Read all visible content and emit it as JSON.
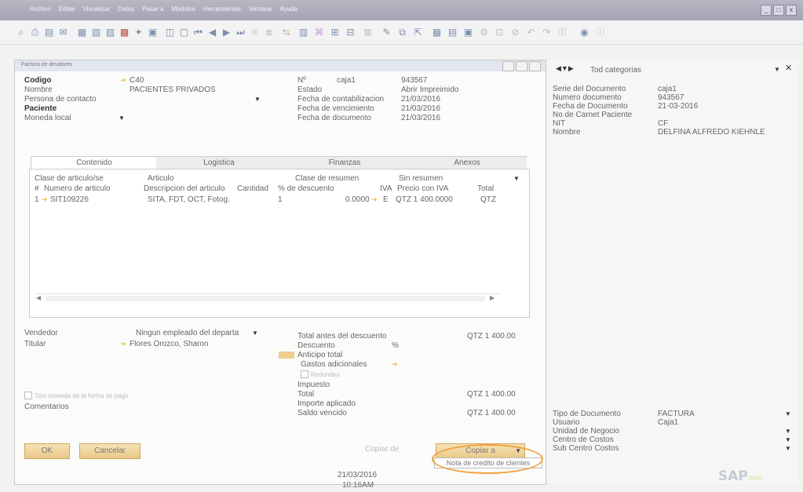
{
  "menubar": {
    "items": [
      "Archivo",
      "Editar",
      "Visualizar",
      "Datos",
      "Pasar a",
      "Módulos",
      "Herramientas",
      "Ventana",
      "Ayuda"
    ],
    "window_controls": [
      "_",
      "□",
      "x"
    ]
  },
  "toolbar": {
    "icons": [
      "search-icon",
      "print-icon",
      "preview-icon",
      "email-icon",
      "excel-icon",
      "word-icon",
      "pdf-icon",
      "settings-icon",
      "find-icon",
      "first-record-icon",
      "prev-record-icon",
      "next-record-icon",
      "last-record-icon",
      "filter-icon",
      "sort-icon",
      "doc-link-icon",
      "drill-icon",
      "copy-icon",
      "layout-icon",
      "calendar-icon",
      "help-icon"
    ]
  },
  "document": {
    "title": "Factura de deudores",
    "codigo_label": "Codigo",
    "codigo_value": "C40",
    "nombre_label": "Nombre",
    "nombre_value": "PACIENTES PRIVADOS",
    "persona_label": "Persona de contacto",
    "paciente_label": "Paciente",
    "moneda_label": "Moneda local",
    "no_label": "Nº",
    "no_series": "caja1",
    "no_value": "943567",
    "estado_label": "Estado",
    "estado_value": "Abrir  Impreimido",
    "fecha_contab_label": "Fecha de contabilizacion",
    "fecha_contab_value": "21/03/2016",
    "fecha_venc_label": "Fecha de vencimiento",
    "fecha_venc_value": "21/03/2016",
    "fecha_doc_label": "Fecha de documento",
    "fecha_doc_value": "21/03/2016"
  },
  "tabs": [
    "Contenido",
    "Logistica",
    "Finanzas",
    "Anexos"
  ],
  "grid": {
    "clase_articulo_label": "Clase de articulo/se",
    "clase_articulo_value": "Articulo",
    "clase_resumen_label": "Clase de resumen",
    "clase_resumen_value": "Sin resumen",
    "columns": [
      "#",
      "Numero de articulo",
      "Descripcion del articulo",
      "Cantidad",
      "% de descuento",
      "IVA",
      "Precio con IVA",
      "Total"
    ],
    "rows": [
      {
        "num": "1",
        "articulo": "SIT109226",
        "descripcion": "SITA, FDT, OCT, Fotog.",
        "cantidad": "1",
        "descuento": "0.0000",
        "iva": "E",
        "precio": "QTZ 1 400.0000",
        "total": "QTZ"
      }
    ]
  },
  "bottom": {
    "vendedor_label": "Vendedor",
    "vendedor_value": "Ningun empleado del departa",
    "titular_label": "Titular",
    "titular_value": "Flores Orozco, Sharon",
    "checkbox_label": "Tipo moneda de la forma de pago",
    "comentarios_label": "Comentarios",
    "total_antes_label": "Total antes del descuento",
    "total_antes_value": "QTZ 1 400.00",
    "descuento_label": "Descuento",
    "descuento_pct": "%",
    "anticipo_label": "Anticipo total",
    "gastos_label": "Gastos adicionales",
    "redondeo_label": "Redondeo",
    "impuesto_label": "Impuesto",
    "total_label": "Total",
    "total_value": "QTZ 1 400.00",
    "importe_label": "Importe aplicado",
    "saldo_label": "Saldo vencido",
    "saldo_value": "QTZ 1 400.00"
  },
  "buttons": {
    "ok": "OK",
    "cancelar": "Cancelar",
    "copiar_de": "Copiar de",
    "copiar_a": "Copiar a",
    "dropdown_option": "Nota de credito de clientes"
  },
  "right_panel": {
    "category": "Tod categorias",
    "fields": [
      {
        "label": "Serie del Documento",
        "value": "caja1"
      },
      {
        "label": "Numero documento",
        "value": "943567"
      },
      {
        "label": "Fecha de Documento",
        "value": "21-03-2016"
      },
      {
        "label": "No de Carnet Paciente",
        "value": ""
      },
      {
        "label": "NIT",
        "value": "CF"
      },
      {
        "label": "Nombre",
        "value": "DELFINA ALFREDO KIEHNLE"
      }
    ],
    "bottom_fields": [
      {
        "label": "Tipo de Documento",
        "value": "FACTURA"
      },
      {
        "label": "Usuario",
        "value": "Caja1"
      },
      {
        "label": "Unidad de Negocio",
        "value": ""
      },
      {
        "label": "Centro de Costos",
        "value": ""
      },
      {
        "label": "Sub Centro Costos",
        "value": ""
      }
    ]
  },
  "status": {
    "date": "21/03/2016",
    "time": "10:16AM"
  },
  "brand": {
    "logo": "SAP",
    "logo_suffix": "one"
  },
  "colors": {
    "accent_yellow": "#e9c887",
    "highlight_circle": "#f0a13a",
    "menubar": "#a8a8b8"
  }
}
